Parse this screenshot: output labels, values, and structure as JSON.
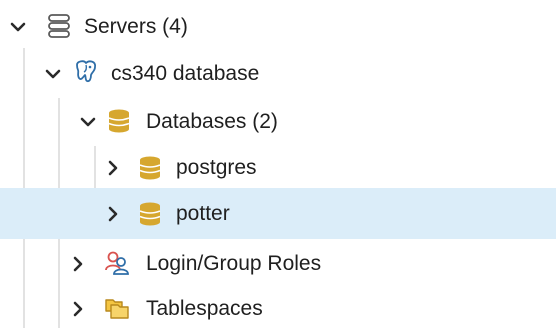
{
  "tree": {
    "servers": {
      "label": "Servers (4)",
      "icon": "servers-icon",
      "expanded": true
    },
    "server": {
      "label": "cs340 database",
      "icon": "postgresql-elephant-icon",
      "expanded": true
    },
    "databases": {
      "label": "Databases (2)",
      "icon": "databases-icon",
      "expanded": true
    },
    "db_items": [
      {
        "label": "postgres",
        "icon": "database-icon",
        "expanded": false,
        "selected": false
      },
      {
        "label": "potter",
        "icon": "database-icon",
        "expanded": false,
        "selected": true
      }
    ],
    "login_roles": {
      "label": "Login/Group Roles",
      "icon": "login-group-roles-icon",
      "expanded": false
    },
    "tablespaces": {
      "label": "Tablespaces",
      "icon": "tablespaces-icon",
      "expanded": false
    }
  },
  "colors": {
    "selection": "#dbedf9",
    "db_gold": "#d6a72f",
    "text": "#1f1f1f",
    "elephant_blue": "#2f6ea8",
    "roles_red": "#d9534f",
    "folder_yellow": "#f4c542"
  }
}
